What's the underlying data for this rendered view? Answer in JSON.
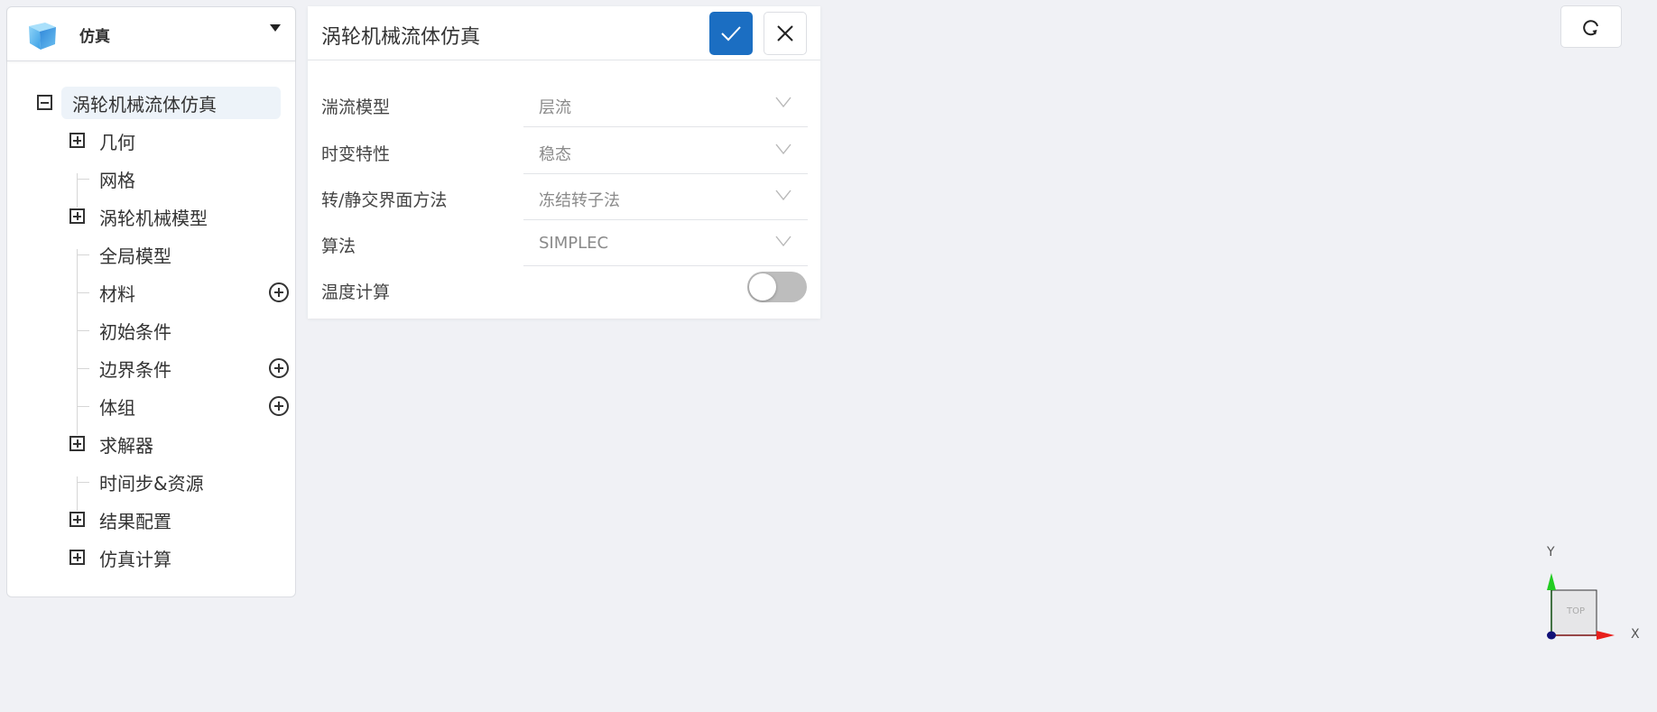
{
  "sidebar": {
    "title": "仿真",
    "logo_icon": "cube-icon",
    "dropdown_icon": "caret-down-icon",
    "tree": {
      "root": {
        "label": "涡轮机械流体仿真",
        "expanded": true,
        "icon": "collapse-box-icon"
      },
      "children": [
        {
          "label": "几何",
          "expandable": true,
          "addable": false
        },
        {
          "label": "网格",
          "expandable": false,
          "addable": false
        },
        {
          "label": "涡轮机械模型",
          "expandable": true,
          "addable": false
        },
        {
          "label": "全局模型",
          "expandable": false,
          "addable": false
        },
        {
          "label": "材料",
          "expandable": false,
          "addable": true
        },
        {
          "label": "初始条件",
          "expandable": false,
          "addable": false
        },
        {
          "label": "边界条件",
          "expandable": false,
          "addable": true
        },
        {
          "label": "体组",
          "expandable": false,
          "addable": true
        },
        {
          "label": "求解器",
          "expandable": true,
          "addable": false
        },
        {
          "label": "时间步&资源",
          "expandable": false,
          "addable": false
        },
        {
          "label": "结果配置",
          "expandable": true,
          "addable": false
        },
        {
          "label": "仿真计算",
          "expandable": true,
          "addable": false
        }
      ]
    }
  },
  "panel": {
    "title": "涡轮机械流体仿真",
    "confirm_icon": "check-icon",
    "close_icon": "close-icon",
    "fields": [
      {
        "label": "湍流模型",
        "type": "select",
        "value": "层流"
      },
      {
        "label": "时变特性",
        "type": "select",
        "value": "稳态"
      },
      {
        "label": "转/静交界面方法",
        "type": "select",
        "value": "冻结转子法"
      },
      {
        "label": "算法",
        "type": "select",
        "value": "SIMPLEC"
      },
      {
        "label": "温度计算",
        "type": "toggle",
        "value": false
      }
    ]
  },
  "viewport": {
    "refresh_icon": "refresh-icon",
    "gizmo": {
      "face_label": "TOP",
      "x_label": "X",
      "y_label": "Y"
    }
  },
  "colors": {
    "accent": "#1b6ec2",
    "selected_row": "#edf3f9",
    "toggle_off": "#bdbdbd",
    "background": "#f0f1f5",
    "x_axis": "#e8201c",
    "y_axis": "#22cc22",
    "origin": "#111177"
  }
}
